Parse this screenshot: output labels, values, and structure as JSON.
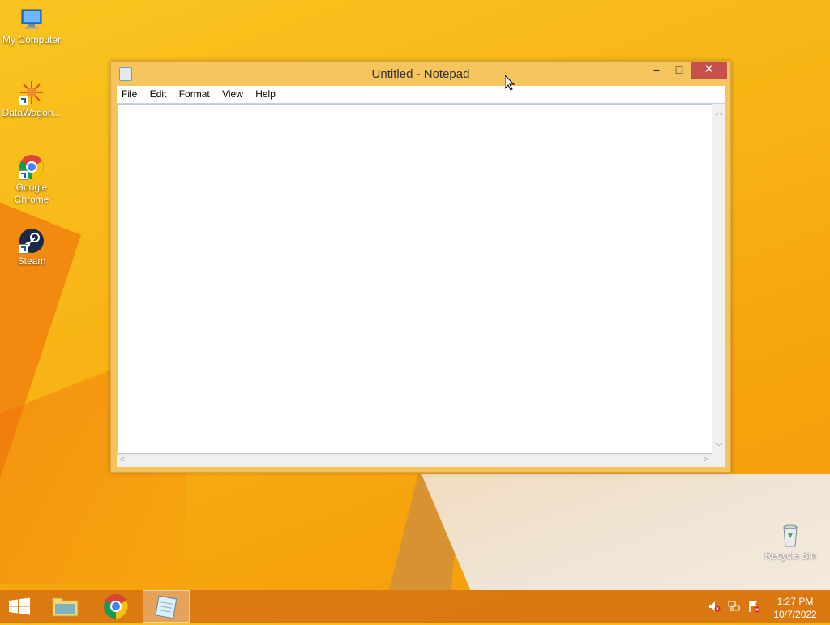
{
  "desktop": {
    "icons": [
      {
        "label": "My Computer",
        "icon": "computer-icon"
      },
      {
        "label": "DataWagon...",
        "icon": "datawagon-icon"
      },
      {
        "label": "Google Chrome",
        "icon": "chrome-icon"
      },
      {
        "label": "Steam",
        "icon": "steam-icon"
      },
      {
        "label": "Recycle Bin",
        "icon": "recycle-bin-icon"
      }
    ]
  },
  "window": {
    "title": "Untitled - Notepad",
    "controls": {
      "minimize": "−",
      "maximize": "□",
      "close": "✕"
    },
    "menu": [
      "File",
      "Edit",
      "Format",
      "View",
      "Help"
    ],
    "content": ""
  },
  "taskbar": {
    "apps": [
      "start-icon",
      "file-explorer-icon",
      "chrome-icon",
      "notepad-icon"
    ],
    "tray": [
      "volume-muted-icon",
      "network-icon",
      "action-center-icon"
    ],
    "clock": {
      "time": "1:27 PM",
      "date": "10/7/2022"
    }
  },
  "colors": {
    "accent": "#f8b515",
    "close": "#c7504a",
    "taskbar": "#d67412"
  }
}
